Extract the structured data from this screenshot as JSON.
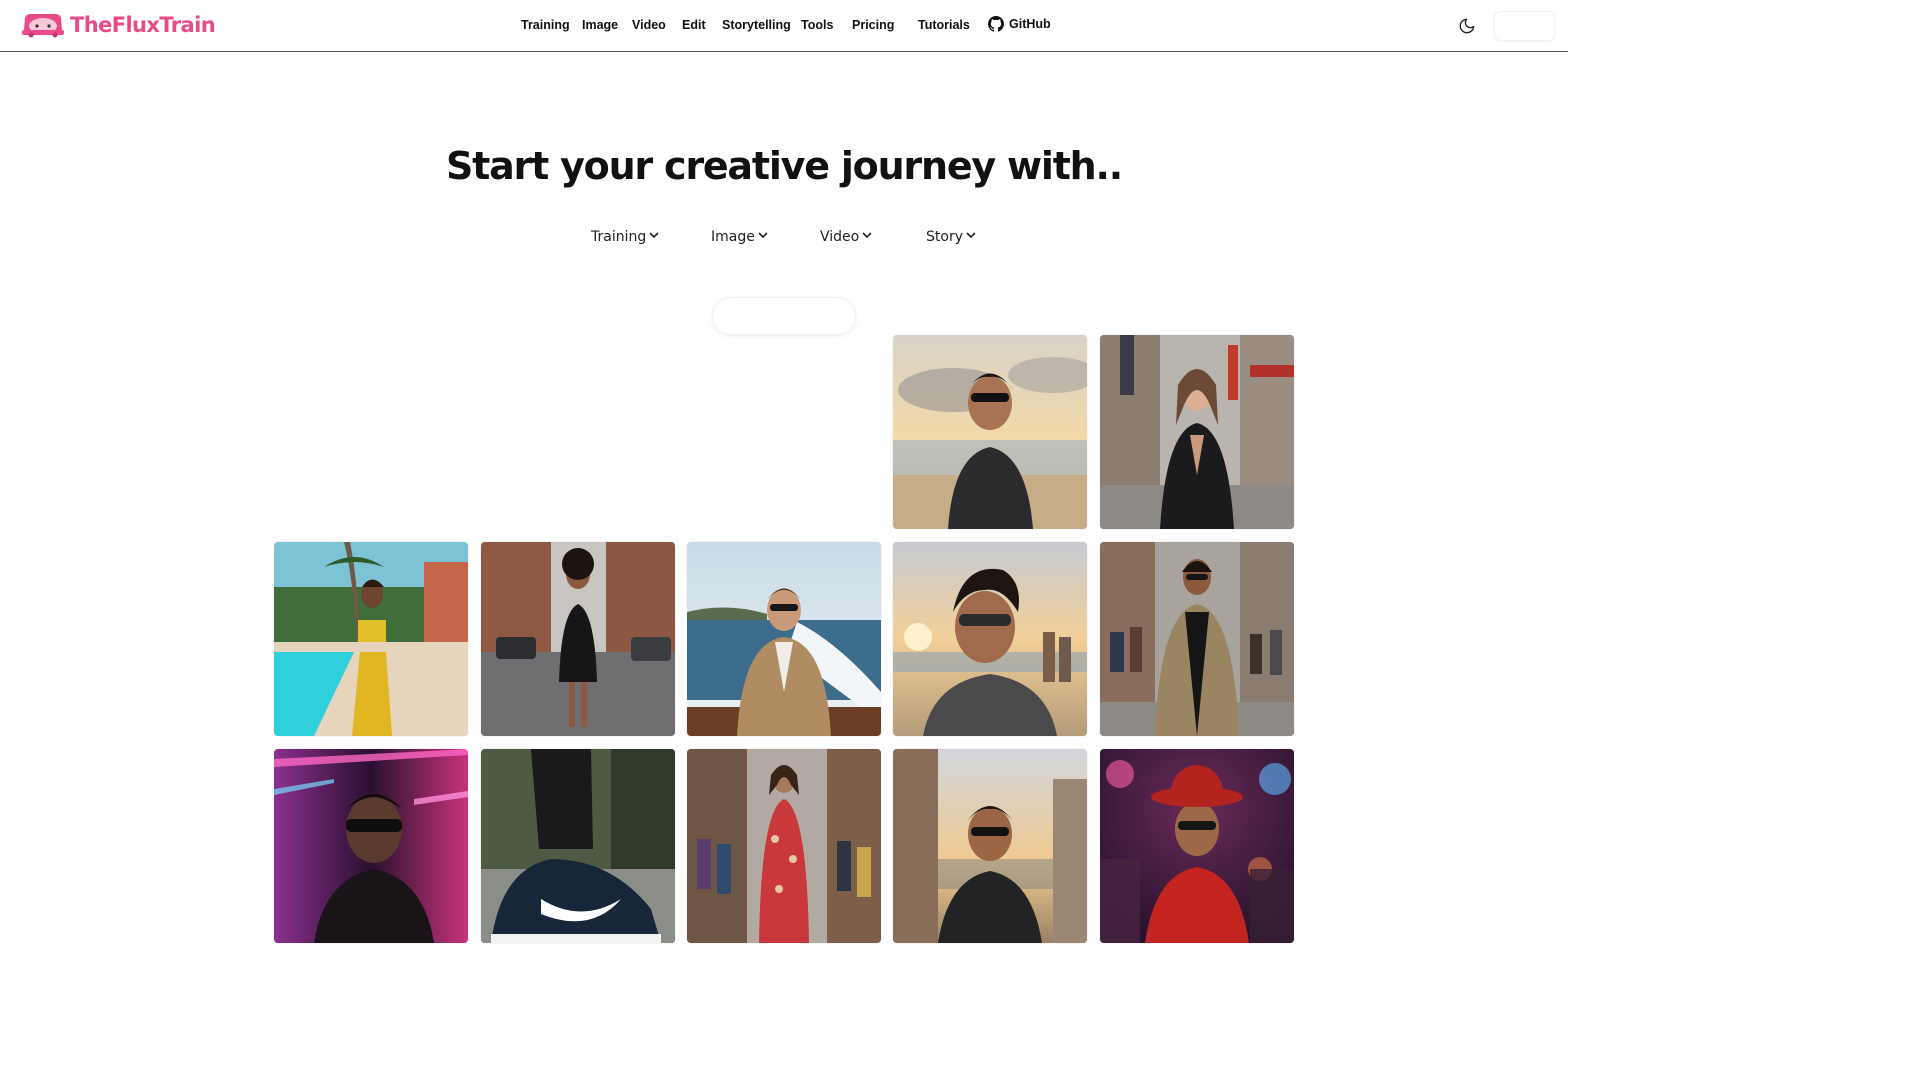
{
  "brand": {
    "name": "TheFluxTrain",
    "color": "#e84a8a"
  },
  "nav": {
    "training": "Training",
    "image": "Image",
    "video": "Video",
    "edit": "Edit",
    "storytelling": "Storytelling",
    "tools": "Tools",
    "pricing": "Pricing",
    "tutorials": "Tutorials",
    "github": "GitHub"
  },
  "header_icons": {
    "theme_toggle": "moon-icon",
    "github": "github-icon"
  },
  "hero": {
    "title": "Start your creative journey with..",
    "dropdowns": [
      "Training",
      "Image",
      "Video",
      "Story"
    ]
  },
  "gallery": [
    {
      "row": 1,
      "col": 4,
      "subject": "man with sunglasses on beach at sunset"
    },
    {
      "row": 1,
      "col": 5,
      "subject": "woman in black suit on city street"
    },
    {
      "row": 2,
      "col": 1,
      "subject": "woman in yellow outfit by pool"
    },
    {
      "row": 2,
      "col": 2,
      "subject": "woman in black dress on street"
    },
    {
      "row": 2,
      "col": 3,
      "subject": "man in tan suit on speedboat"
    },
    {
      "row": 2,
      "col": 4,
      "subject": "man selfie on beach at sunset"
    },
    {
      "row": 2,
      "col": 5,
      "subject": "man in trench coat on busy street"
    },
    {
      "row": 3,
      "col": 1,
      "subject": "man with sunglasses in neon lights"
    },
    {
      "row": 3,
      "col": 2,
      "subject": "black sneaker close-up"
    },
    {
      "row": 3,
      "col": 3,
      "subject": "woman in red floral dress in market street"
    },
    {
      "row": 3,
      "col": 4,
      "subject": "man with sunglasses in city at sunset"
    },
    {
      "row": 3,
      "col": 5,
      "subject": "man in red hat at party"
    }
  ]
}
